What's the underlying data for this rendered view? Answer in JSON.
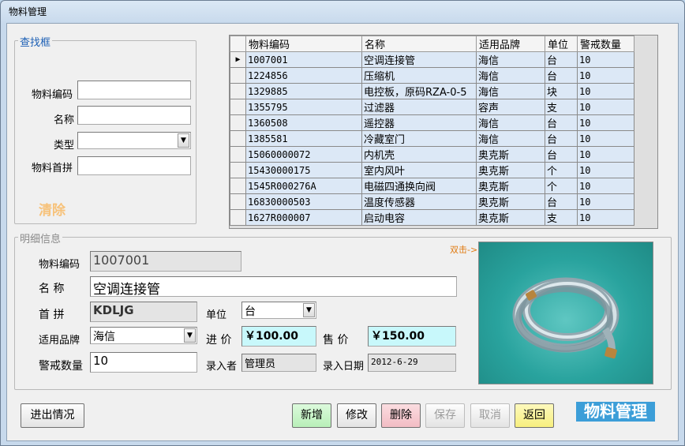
{
  "window": {
    "title": "物料管理"
  },
  "search": {
    "legend": "查找框",
    "code_label": "物料编码",
    "name_label": "名称",
    "type_label": "类型",
    "pinyin_label": "物料首拼",
    "code_value": "",
    "name_value": "",
    "type_value": "",
    "pinyin_value": "",
    "clear_label": "清除"
  },
  "grid": {
    "headers": [
      "物料编码",
      "名称",
      "适用品牌",
      "单位",
      "警戒数量"
    ],
    "rows": [
      [
        "1007001",
        "空调连接管",
        "海信",
        "台",
        "10"
      ],
      [
        "1224856",
        "压缩机",
        "海信",
        "台",
        "10"
      ],
      [
        "1329885",
        "电控板，原码RZA-0-5",
        "海信",
        "块",
        "10"
      ],
      [
        "1355795",
        "过滤器",
        "容声",
        "支",
        "10"
      ],
      [
        "1360508",
        "遥控器",
        "海信",
        "台",
        "10"
      ],
      [
        "1385581",
        "冷藏室门",
        "海信",
        "台",
        "10"
      ],
      [
        "15060000072",
        "内机壳",
        "奥克斯",
        "台",
        "10"
      ],
      [
        "15430000175",
        "室内风叶",
        "奥克斯",
        "个",
        "10"
      ],
      [
        "1545R000276A",
        "电磁四通换向阀",
        "奥克斯",
        "个",
        "10"
      ],
      [
        "16830000503",
        "温度传感器",
        "奥克斯",
        "台",
        "10"
      ],
      [
        "1627R000007",
        "启动电容",
        "奥克斯",
        "支",
        "10"
      ]
    ],
    "selected_marker": "▶"
  },
  "detail": {
    "legend": "明细信息",
    "code_label": "物料编码",
    "code_value": "1007001",
    "name_label": "名 称",
    "name_value": "空调连接管",
    "pinyin_label": "首 拼",
    "pinyin_value": "KDLJG",
    "unit_label": "单位",
    "unit_value": "台",
    "brand_label": "适用品牌",
    "brand_value": "海信",
    "buy_price_label": "进 价",
    "buy_price_value": "￥100.00",
    "sell_price_label": "售 价",
    "sell_price_value": "￥150.00",
    "alert_label": "警戒数量",
    "alert_value": "10",
    "entered_by_label": "录入者",
    "entered_by_value": "管理员",
    "entry_date_label": "录入日期",
    "entry_date_value": "2012-6-29",
    "dblclick_hint": "双击->"
  },
  "buttons": {
    "io": "进出情况",
    "add": "新增",
    "edit": "修改",
    "delete": "删除",
    "save": "保存",
    "cancel": "取消",
    "back": "返回"
  },
  "brand_banner": "物料管理",
  "colors": {
    "add_button": "#c4f5c4",
    "delete_button": "#f6c9cf",
    "back_button": "#fbf497",
    "clear_text": "#f7c27a",
    "banner_bg": "#3c9ed8",
    "hint_text": "#e07a10"
  }
}
